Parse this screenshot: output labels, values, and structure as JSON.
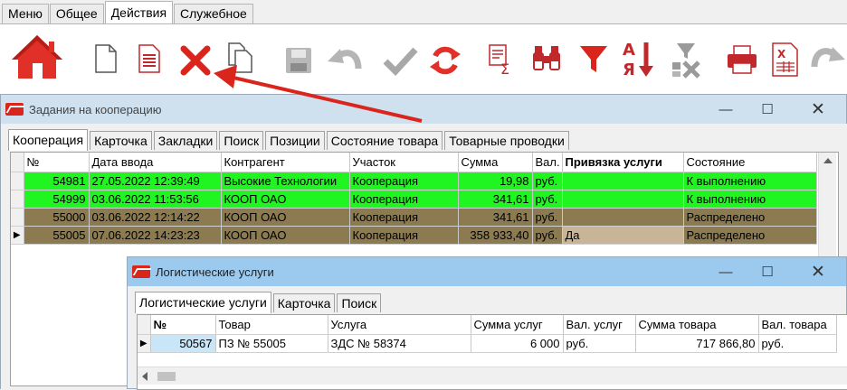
{
  "menu_tabs": [
    "Меню",
    "Общее",
    "Действия",
    "Служебное"
  ],
  "active_menu_tab": "Действия",
  "toolbar_icons": [
    "home-icon",
    "new-document-icon",
    "document-lines-icon",
    "delete-x-icon",
    "copy-document-icon",
    "save-icon",
    "undo-icon",
    "check-icon",
    "refresh-icon",
    "sum-icon",
    "binoculars-icon",
    "filter-icon",
    "sort-az-icon",
    "clear-filter-icon",
    "print-icon",
    "excel-icon",
    "redo-icon"
  ],
  "colors": {
    "green_row": "#21f521",
    "brown_row": "#8c7a50",
    "arrow": "#d9251c",
    "selected_cell": "#c8b497"
  },
  "window1": {
    "title": "Задания на кооперацию",
    "tabs": [
      "Кооперация",
      "Карточка",
      "Закладки",
      "Поиск",
      "Позиции",
      "Состояние товара",
      "Товарные проводки"
    ],
    "columns": [
      "№",
      "Дата ввода",
      "Контрагент",
      "Участок",
      "Сумма",
      "Вал.",
      "Привязка услуги",
      "Состояние"
    ],
    "rows": [
      {
        "num": "54981",
        "date": "27.05.2022 12:39:49",
        "partner": "Высокие Технологии",
        "area": "Кооперация",
        "sum": "19,98",
        "cur": "руб.",
        "link": "",
        "state": "К выполнению",
        "color": "green"
      },
      {
        "num": "54999",
        "date": "03.06.2022 11:53:56",
        "partner": "КООП ОАО",
        "area": "Кооперация",
        "sum": "341,61",
        "cur": "руб.",
        "link": "",
        "state": "К выполнению",
        "color": "green"
      },
      {
        "num": "55000",
        "date": "03.06.2022 12:14:22",
        "partner": "КООП ОАО",
        "area": "Кооперация",
        "sum": "341,61",
        "cur": "руб.",
        "link": "",
        "state": "Распределено",
        "color": "brown"
      },
      {
        "num": "55005",
        "date": "07.06.2022 14:23:23",
        "partner": "КООП ОАО",
        "area": "Кооперация",
        "sum": "358 933,40",
        "cur": "руб.",
        "link": "Да",
        "state": "Распределено",
        "color": "brown"
      }
    ]
  },
  "window2": {
    "title": "Логистические услуги",
    "tabs": [
      "Логистические услуги",
      "Карточка",
      "Поиск"
    ],
    "columns": [
      "№",
      "Товар",
      "Услуга",
      "Сумма услуг",
      "Вал. услуг",
      "Сумма товара",
      "Вал. товара"
    ],
    "rows": [
      {
        "num": "50567",
        "product": "ПЗ № 55005",
        "service": "ЗДС № 58374",
        "service_sum": "6 000",
        "service_cur": "руб.",
        "product_sum": "717 866,80",
        "product_cur": "руб."
      }
    ]
  }
}
